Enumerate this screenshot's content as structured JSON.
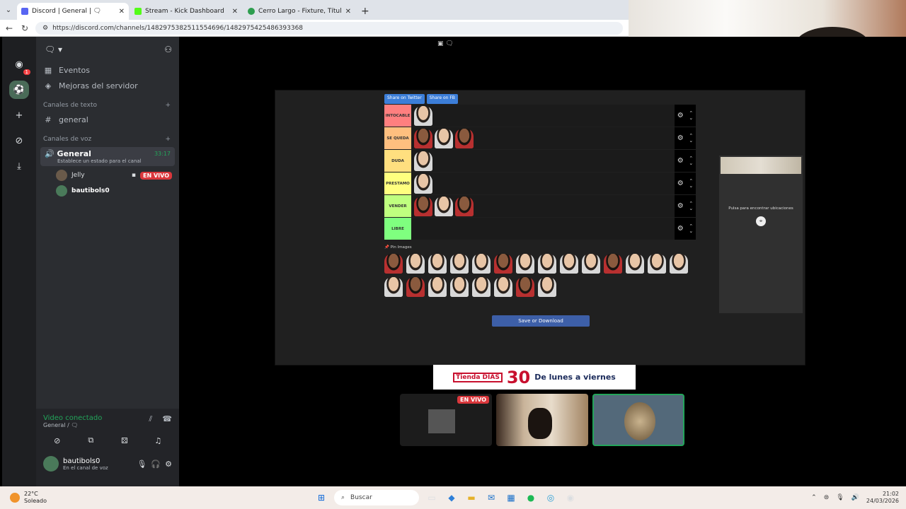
{
  "browser": {
    "tabs": [
      {
        "title": "Discord | General | 🗨",
        "close": "✕",
        "color": "#5865f2",
        "active": true
      },
      {
        "title": "Stream - Kick Dashboard",
        "close": "✕",
        "color": "#53fc18",
        "active": false
      },
      {
        "title": "Cerro Largo - Fixture, Títulos y Pla",
        "close": "✕",
        "color": "#2e9e4f",
        "active": false
      }
    ],
    "new_tab": "+",
    "url": "https://discord.com/channels/1482975382511554696/1482975425486393368"
  },
  "server": {
    "name": "🗨 ▾",
    "items": [
      {
        "icon": "calendar-icon",
        "label": "Eventos"
      },
      {
        "icon": "boost-icon",
        "label": "Mejoras del servidor"
      }
    ],
    "text_category": "Canales de texto",
    "text_channels": [
      {
        "label": "general"
      }
    ],
    "voice_category": "Canales de voz",
    "voice_channel": {
      "label": "General",
      "timer": "33:17",
      "status": "Establece un estado para el canal"
    },
    "voice_users": [
      {
        "name": "Jelly",
        "live": "EN VIVO"
      },
      {
        "name": "bautibols0"
      }
    ]
  },
  "rail": {
    "badge": "1"
  },
  "voice_panel": {
    "title": "Video conectado",
    "subtitle": "General / 🗨"
  },
  "user_bar": {
    "name": "bautibols0",
    "status": "En el canal de voz"
  },
  "stage": {
    "share_twitter": "Share on Twitter",
    "share_fb": "Share on FB",
    "tiers": [
      {
        "label": "INTOCABLE",
        "color": "#ff7f7f",
        "count": 1
      },
      {
        "label": "SE QUEDA",
        "color": "#ffbf7f",
        "count": 3
      },
      {
        "label": "DUDA",
        "color": "#ffdf7f",
        "count": 1
      },
      {
        "label": "PRESTAMO",
        "color": "#ffff7f",
        "count": 1
      },
      {
        "label": "VENDER",
        "color": "#bfff7f",
        "count": 3
      },
      {
        "label": "LIBRE",
        "color": "#7fff7f",
        "count": 0
      }
    ],
    "pin_label": "Pin Images",
    "pool_count": 22,
    "save_label": "Save or Download",
    "map_text": "Pulsa para encontrar ubicaciones",
    "ad_box": "Tienda DÍAS",
    "ad_number": "30",
    "ad_text": "De lunes a viernes",
    "tile_live": "EN VIVO"
  },
  "taskbar": {
    "temp": "22°C",
    "weather": "Soleado",
    "search": "Buscar",
    "time": "21:02",
    "date": "24/03/2026"
  }
}
